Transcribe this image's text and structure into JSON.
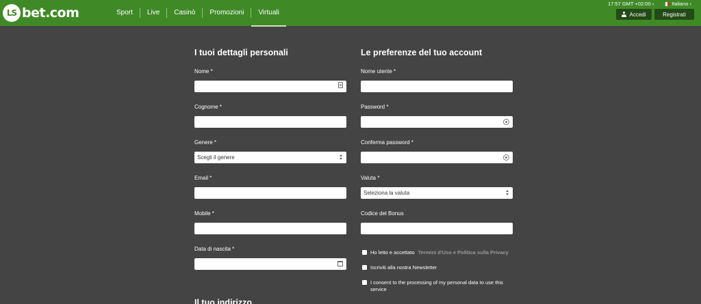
{
  "header": {
    "logo_mark": "LS",
    "logo_text": "bet.com",
    "nav": [
      "Sport",
      "Live",
      "Casinò",
      "Promozioni",
      "Virtuali"
    ],
    "time": "17:57 GMT +02:00",
    "language": "Italiano",
    "login_label": "Accedi",
    "register_label": "Registrati",
    "colors": {
      "brand": "#3f8a27",
      "button": "#234a18",
      "page_bg": "#444444"
    }
  },
  "personal": {
    "title": "I tuoi dettagli personali",
    "fields": {
      "nome": {
        "label": "Nome *",
        "value": ""
      },
      "cognome": {
        "label": "Cognome *",
        "value": ""
      },
      "genere": {
        "label": "Genere *",
        "value": "Scegli il genere"
      },
      "email": {
        "label": "Email *",
        "value": ""
      },
      "mobile": {
        "label": "Mobile *",
        "value": ""
      },
      "nascita": {
        "label": "Data di nascita *",
        "value": ""
      }
    }
  },
  "account": {
    "title": "Le preferenze del tuo account",
    "fields": {
      "username": {
        "label": "Nome utente *",
        "value": ""
      },
      "password": {
        "label": "Password *",
        "value": ""
      },
      "confirm": {
        "label": "Conferma password *",
        "value": ""
      },
      "valuta": {
        "label": "Valuta *",
        "value": "Seleziona la valuta"
      },
      "bonus": {
        "label": "Codice del Bonus",
        "value": ""
      }
    },
    "checks": {
      "terms_text": "Ho letto e accettato",
      "terms_link": "Termini d'Uso e Politica sulla Privacy",
      "newsletter": "Iscriviti alla nostra Newsletter",
      "consent": "I consent to the processing of my personal data to use this service"
    }
  },
  "address": {
    "title": "Il tuo indirizzo"
  }
}
